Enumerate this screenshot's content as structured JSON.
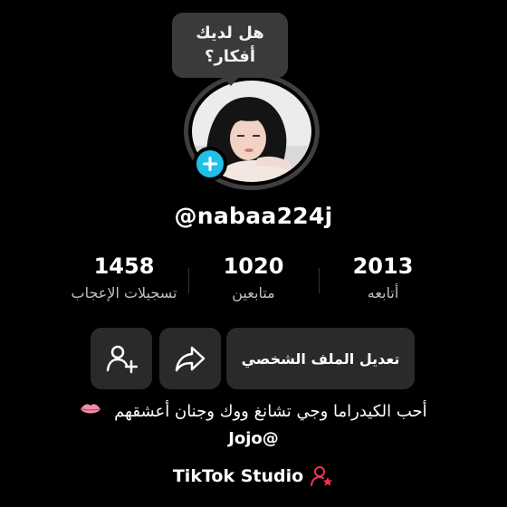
{
  "tooltip": {
    "line1": "هل لديك",
    "line2": "أفكار؟"
  },
  "profile": {
    "username": "@nabaa224j"
  },
  "stats": [
    {
      "value": "1458",
      "label": "تسجيلات الإعجاب"
    },
    {
      "value": "1020",
      "label": "متابعين"
    },
    {
      "value": "2013",
      "label": "أتابعه"
    }
  ],
  "actions": {
    "edit_profile": "تعديل الملف الشخصي"
  },
  "bio": {
    "line1": "أحب الكيدراما  وجي تشانغ ووك  وجنان أعشقهم",
    "line2": "Jojo@"
  },
  "studio": {
    "label": "TikTok Studio"
  },
  "icons": {
    "add": "plus-icon",
    "add_friend": "add-user-icon",
    "share": "share-icon",
    "lips": "lips-icon",
    "studio": "user-star-icon"
  },
  "colors": {
    "accent_blue": "#20c0e8",
    "studio_pink": "#fe2c55"
  }
}
